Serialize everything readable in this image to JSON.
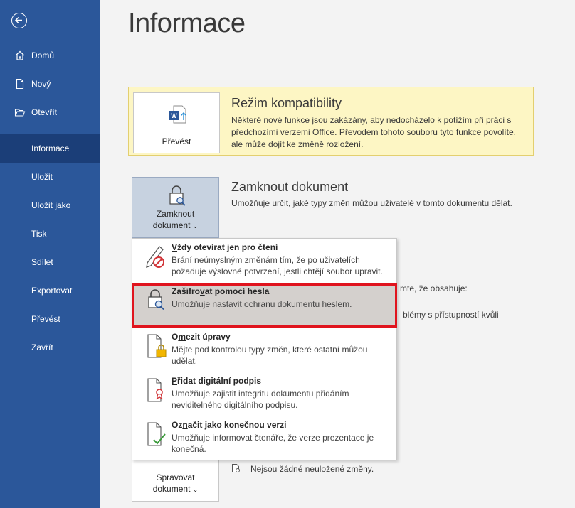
{
  "sidebar": {
    "items_top": [
      {
        "label": "Domů",
        "icon": "home-icon"
      },
      {
        "label": "Nový",
        "icon": "new-document-icon"
      },
      {
        "label": "Otevřít",
        "icon": "folder-icon"
      }
    ],
    "items": [
      {
        "label": "Informace",
        "active": true
      },
      {
        "label": "Uložit"
      },
      {
        "label": "Uložit jako"
      },
      {
        "label": "Tisk"
      },
      {
        "label": "Sdílet"
      },
      {
        "label": "Exportovat"
      },
      {
        "label": "Převést"
      },
      {
        "label": "Zavřít"
      }
    ]
  },
  "main": {
    "title": "Informace",
    "compat": {
      "button_label": "Převést",
      "title": "Režim kompatibility",
      "description": "Některé nové funkce jsou zakázány, aby nedocházelo k potížím při práci s předchozími verzemi Office. Převodem tohoto souboru tyto funkce povolíte, ale může dojít ke změně rozložení."
    },
    "protect": {
      "button_line1": "Zamknout",
      "button_line2": "dokument",
      "title": "Zamknout dokument",
      "description": "Umožňuje určit, jaké typy změn můžou uživatelé v tomto dokumentu dělat."
    },
    "partial_text_1": "mte, že obsahuje:",
    "partial_text_2": "blémy s přístupností kvůli",
    "manage": {
      "button_line1": "Spravovat",
      "button_line2": "dokument",
      "status": "Nejsou žádné neuložené změny."
    }
  },
  "menu": {
    "items": [
      {
        "title_pre": "",
        "title_key": "V",
        "title_post": "ždy otevírat jen pro čtení",
        "description": "Brání neúmyslným změnám tím, že po uživatelích požaduje výslovné potvrzení, jestli chtějí soubor upravit.",
        "icon": "read-only-pencil-icon"
      },
      {
        "title_pre": "Zašifro",
        "title_key": "v",
        "title_post": "at pomocí hesla",
        "description": "Umožňuje nastavit ochranu dokumentu heslem.",
        "icon": "lock-key-icon",
        "highlighted": true
      },
      {
        "title_pre": "O",
        "title_key": "m",
        "title_post": "ezit úpravy",
        "description": "Mějte pod kontrolou typy změn, které ostatní můžou udělat.",
        "icon": "restrict-editing-icon"
      },
      {
        "title_pre": "",
        "title_key": "P",
        "title_post": "řidat digitální podpis",
        "description": "Umožňuje zajistit integritu dokumentu přidáním neviditelného digitálního podpisu.",
        "icon": "digital-signature-icon"
      },
      {
        "title_pre": "Oz",
        "title_key": "n",
        "title_post": "ačit jako konečnou verzi",
        "description": "Umožňuje informovat čtenáře, že verze prezentace je konečná.",
        "icon": "mark-final-icon"
      }
    ]
  },
  "colors": {
    "sidebar_bg": "#2b579a",
    "sidebar_active": "#1b3e78",
    "compat_bg": "#fdf6c4",
    "highlight_box": "#e0141e"
  }
}
